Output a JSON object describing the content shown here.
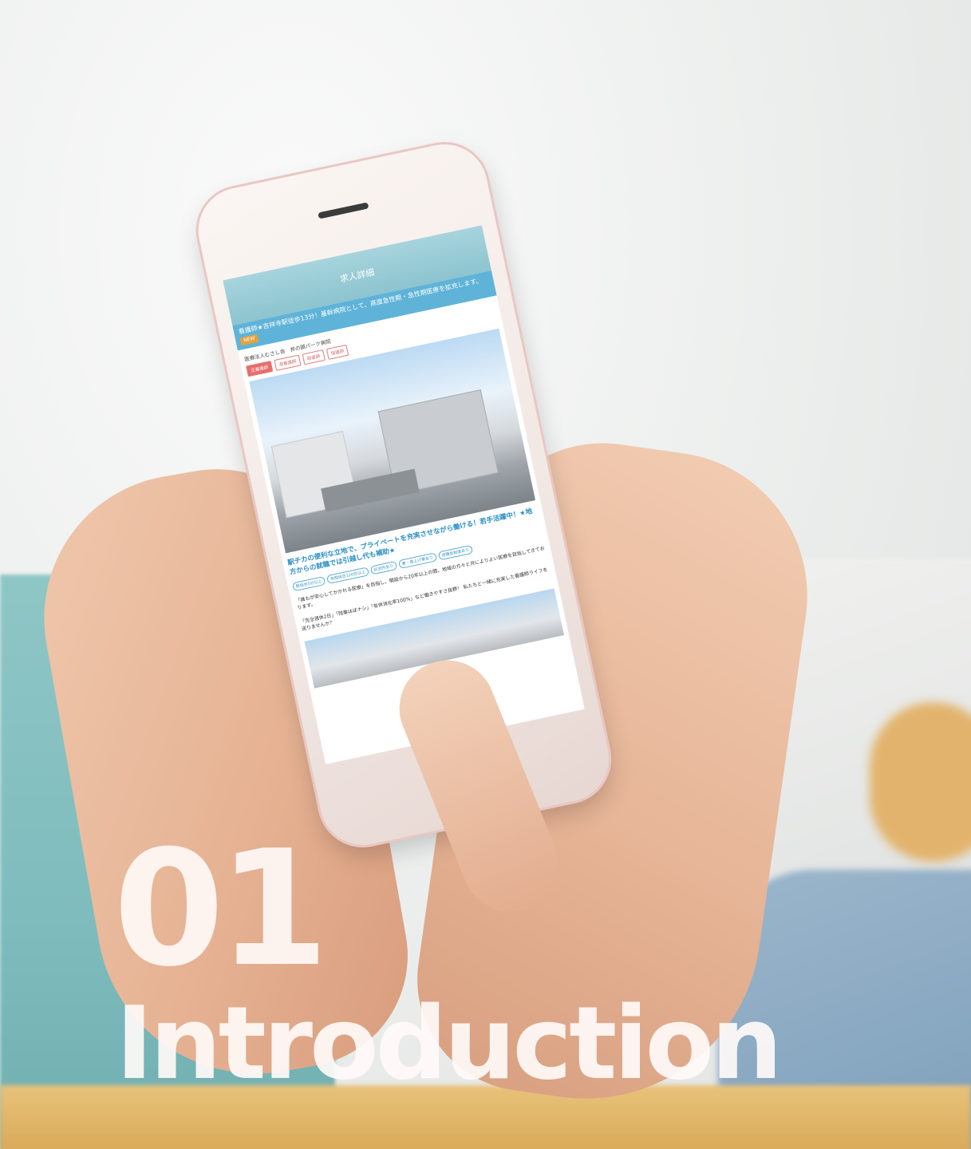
{
  "screen": {
    "header_title": "求人詳細",
    "job_title": "看護師★吉祥寺駅徒歩13分！基幹病院として、高度急性期・急性期医療を拡充します。",
    "new_badge": "NEW",
    "company": "医療法人むさし会　井の頭パーク病院",
    "tags": [
      "正看護師",
      "准看護師",
      "助産師",
      "保健師"
    ],
    "headline": "駅チカの便利な立地で、プライベートを充実させながら働ける！若手活躍中！★地方からの就職では引越し代も補助★",
    "chips": [
      "駅徒歩5分以上",
      "年間休日120日以上",
      "託児所あり",
      "寮・借上げ寮あり",
      "退職金制度あり"
    ],
    "paragraph1": "「誰もが安心してかかれる医療」を目指し、開設から20年以上の間、地域の方々と共によりよい医療を目指してきております。",
    "paragraph2": "「完全週休2日」「残業ほぼナシ」「有休消化率100%」など働きやすさ抜群！ 私たちと一緒に充実した看護師ライフを送りませんか？"
  },
  "overlay": {
    "number": "01",
    "word": "Introduction"
  }
}
